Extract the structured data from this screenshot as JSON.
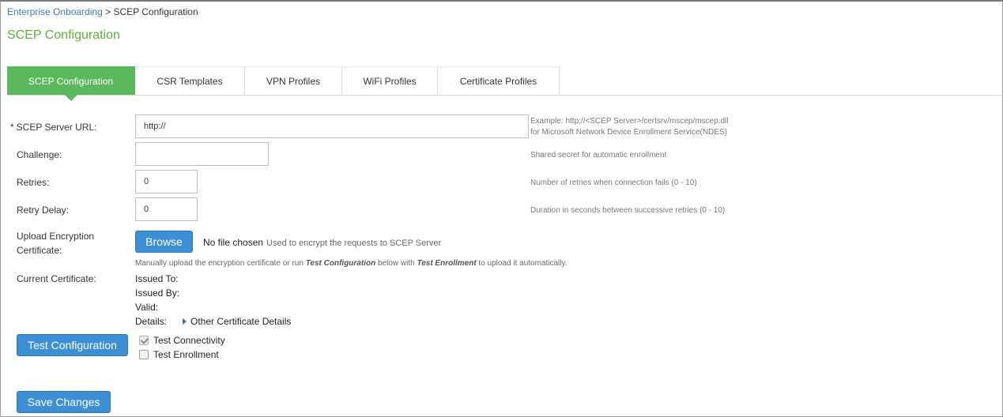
{
  "breadcrumb": {
    "parent": "Enterprise Onboarding",
    "separator": " > ",
    "current": "SCEP Configuration"
  },
  "page_title": "SCEP Configuration",
  "tabs": [
    {
      "label": "SCEP Configuration",
      "active": true
    },
    {
      "label": "CSR Templates",
      "active": false
    },
    {
      "label": "VPN Profiles",
      "active": false
    },
    {
      "label": "WiFi Profiles",
      "active": false
    },
    {
      "label": "Certificate Profiles",
      "active": false
    }
  ],
  "form": {
    "scep_url": {
      "required_marker": "*",
      "label": "SCEP Server URL:",
      "value": "http://",
      "hint_line1": "Example: http://<SCEP Server>/certsrv/mscep/mscep.dll",
      "hint_line2": "for Microsoft Network Device Enrollment Service(NDES)"
    },
    "challenge": {
      "label": "Challenge:",
      "value": "",
      "hint": "Shared secret for automatic enrollment"
    },
    "retries": {
      "label": "Retries:",
      "value": "0",
      "hint": "Number of retries when connection fails (0 - 10)"
    },
    "retry_delay": {
      "label": "Retry Delay:",
      "value": "0",
      "hint": "Duration in seconds between successive retries (0 - 10)"
    },
    "upload": {
      "label_line1": "Upload Encryption",
      "label_line2": "Certificate:",
      "browse_label": "Browse",
      "file_status": "No file chosen",
      "file_note": "Used to encrypt the requests to SCEP Server",
      "manual_prefix": "Manually upload the encryption certificate or run ",
      "manual_bold1": "Test Configuration",
      "manual_mid": " below with ",
      "manual_bold2": "Test Enrollment",
      "manual_suffix": " to upload it automatically."
    },
    "current_certificate": {
      "label": "Current Certificate:",
      "issued_to": "Issued To:",
      "issued_by": "Issued By:",
      "valid": "Valid:",
      "details": "Details:",
      "details_link": "Other Certificate Details"
    }
  },
  "test": {
    "button_label": "Test Configuration",
    "connectivity": {
      "label": "Test Connectivity",
      "checked": true
    },
    "enrollment": {
      "label": "Test Enrollment",
      "checked": false
    }
  },
  "save_label": "Save Changes",
  "colors": {
    "accent_green": "#5cb85c",
    "title_green": "#5cb234",
    "button_blue": "#3d8fd5",
    "link_blue": "#3a7ab8"
  }
}
